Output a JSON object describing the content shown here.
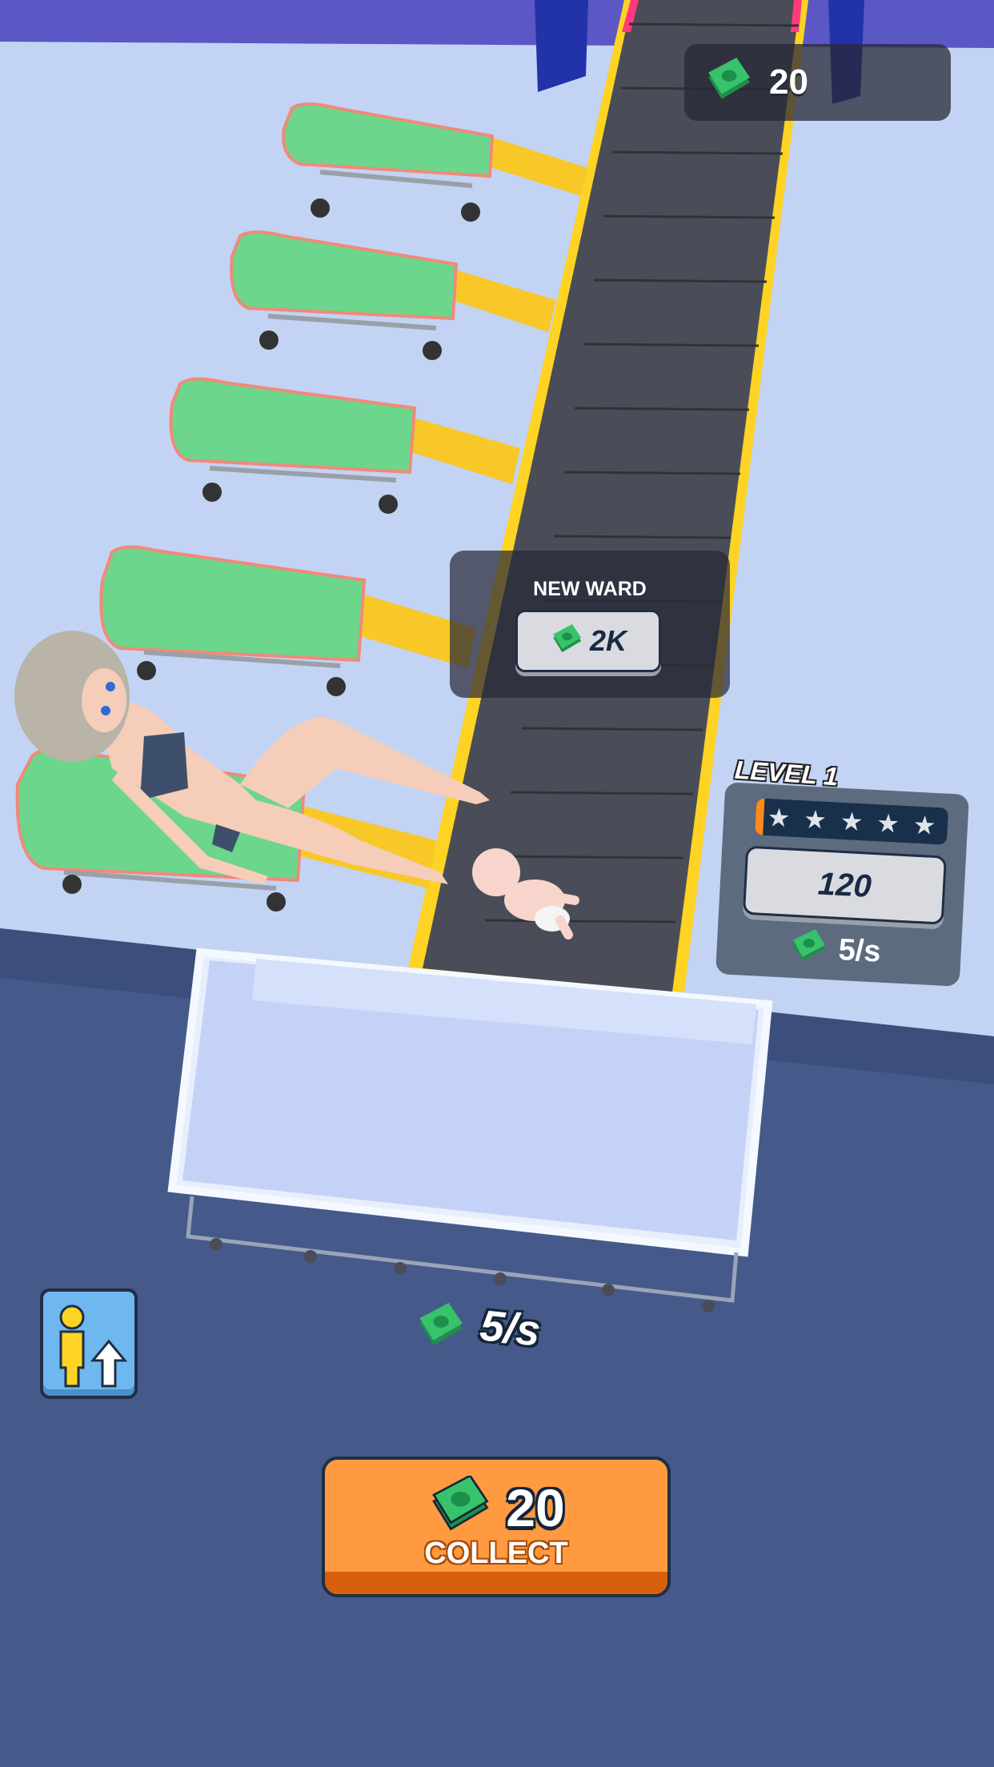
{
  "hud": {
    "money": "20",
    "money_icon": "cash-icon"
  },
  "new_ward": {
    "title": "NEW WARD",
    "cost": "2K"
  },
  "level": {
    "title": "LEVEL 1",
    "stars_total": 5,
    "progress": 0.04,
    "upgrade_cost": "120",
    "rate": "5/s"
  },
  "rate_below": "5/s",
  "upgrade_button": {
    "icon": "person-upgrade-icon"
  },
  "collect": {
    "amount": "20",
    "label": "COLLECT"
  },
  "colors": {
    "floor": "#c3d3f4",
    "lower_floor": "#455a8a",
    "bed": "#6cd68c",
    "belt": "#4a4d58",
    "rail": "#ffd324",
    "accent": "#ff9a40"
  }
}
